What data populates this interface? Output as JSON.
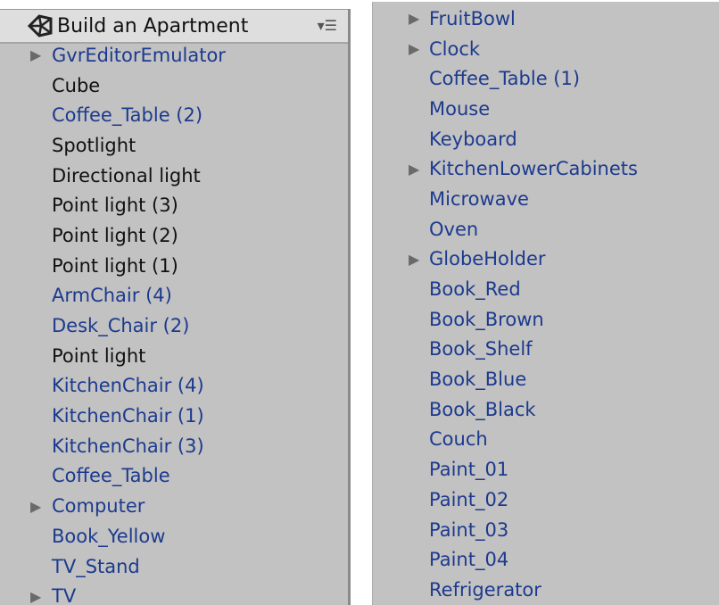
{
  "header": {
    "title": "Build an Apartment",
    "menu_icon": "dropdown-menu-icon"
  },
  "colors": {
    "prefab": "#1c3a8e",
    "object": "#111111",
    "background": "#c2c2c2"
  },
  "left_items": [
    {
      "label": "GvrEditorEmulator",
      "prefab": true,
      "expandable": true
    },
    {
      "label": "Cube",
      "prefab": false,
      "expandable": false
    },
    {
      "label": "Coffee_Table (2)",
      "prefab": true,
      "expandable": false
    },
    {
      "label": "Spotlight",
      "prefab": false,
      "expandable": false
    },
    {
      "label": "Directional light",
      "prefab": false,
      "expandable": false
    },
    {
      "label": "Point light (3)",
      "prefab": false,
      "expandable": false
    },
    {
      "label": "Point light (2)",
      "prefab": false,
      "expandable": false
    },
    {
      "label": "Point light (1)",
      "prefab": false,
      "expandable": false
    },
    {
      "label": "ArmChair (4)",
      "prefab": true,
      "expandable": false
    },
    {
      "label": "Desk_Chair (2)",
      "prefab": true,
      "expandable": false
    },
    {
      "label": "Point light",
      "prefab": false,
      "expandable": false
    },
    {
      "label": "KitchenChair (4)",
      "prefab": true,
      "expandable": false
    },
    {
      "label": "KitchenChair (1)",
      "prefab": true,
      "expandable": false
    },
    {
      "label": "KitchenChair (3)",
      "prefab": true,
      "expandable": false
    },
    {
      "label": "Coffee_Table",
      "prefab": true,
      "expandable": false
    },
    {
      "label": "Computer",
      "prefab": true,
      "expandable": true
    },
    {
      "label": "Book_Yellow",
      "prefab": true,
      "expandable": false
    },
    {
      "label": "TV_Stand",
      "prefab": true,
      "expandable": false
    },
    {
      "label": "TV",
      "prefab": true,
      "expandable": true
    }
  ],
  "right_items": [
    {
      "label": "FruitBowl",
      "prefab": true,
      "expandable": true
    },
    {
      "label": "Clock",
      "prefab": true,
      "expandable": true
    },
    {
      "label": "Coffee_Table (1)",
      "prefab": true,
      "expandable": false
    },
    {
      "label": "Mouse",
      "prefab": true,
      "expandable": false
    },
    {
      "label": "Keyboard",
      "prefab": true,
      "expandable": false
    },
    {
      "label": "KitchenLowerCabinets",
      "prefab": true,
      "expandable": true
    },
    {
      "label": "Microwave",
      "prefab": true,
      "expandable": false
    },
    {
      "label": "Oven",
      "prefab": true,
      "expandable": false
    },
    {
      "label": "GlobeHolder",
      "prefab": true,
      "expandable": true
    },
    {
      "label": "Book_Red",
      "prefab": true,
      "expandable": false
    },
    {
      "label": "Book_Brown",
      "prefab": true,
      "expandable": false
    },
    {
      "label": "Book_Shelf",
      "prefab": true,
      "expandable": false
    },
    {
      "label": "Book_Blue",
      "prefab": true,
      "expandable": false
    },
    {
      "label": "Book_Black",
      "prefab": true,
      "expandable": false
    },
    {
      "label": "Couch",
      "prefab": true,
      "expandable": false
    },
    {
      "label": "Paint_01",
      "prefab": true,
      "expandable": false
    },
    {
      "label": "Paint_02",
      "prefab": true,
      "expandable": false
    },
    {
      "label": "Paint_03",
      "prefab": true,
      "expandable": false
    },
    {
      "label": "Paint_04",
      "prefab": true,
      "expandable": false
    },
    {
      "label": "Refrigerator",
      "prefab": true,
      "expandable": false
    }
  ]
}
